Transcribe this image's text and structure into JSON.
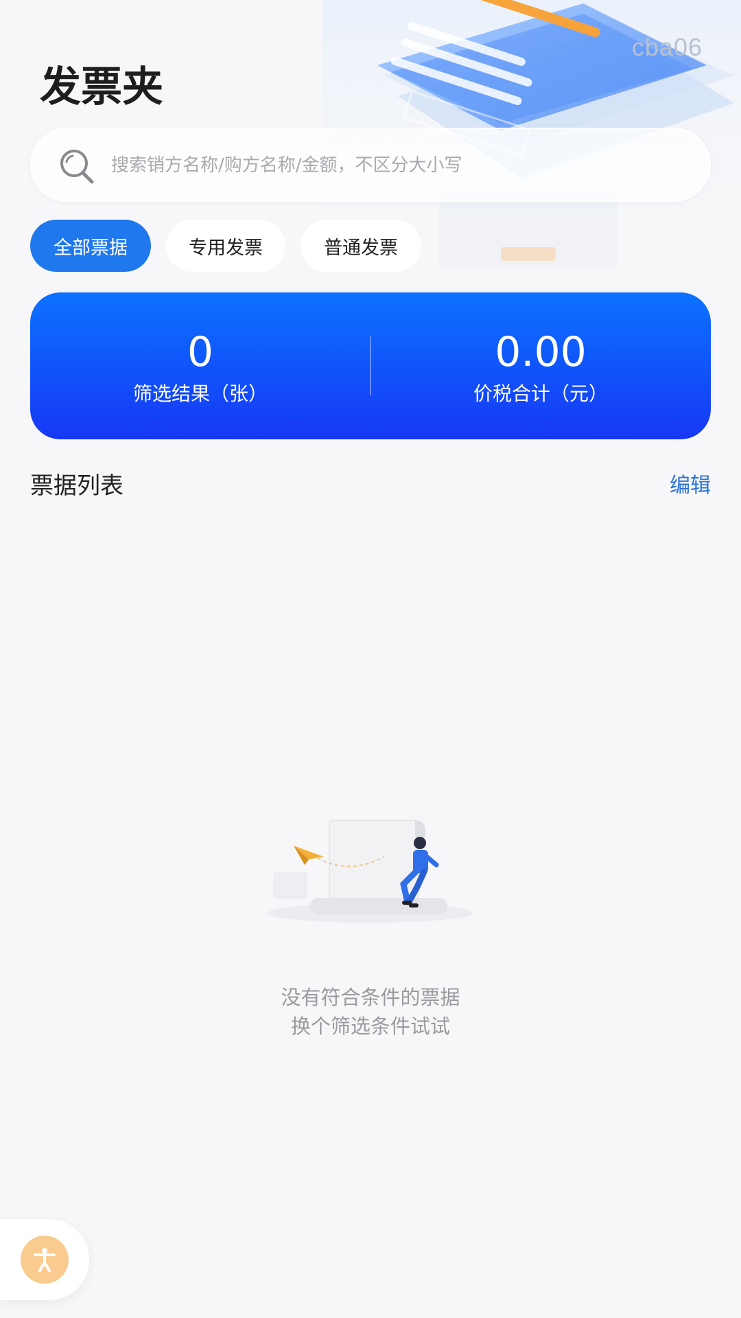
{
  "header": {
    "title": "发票夹",
    "user_tag": "cba06"
  },
  "search": {
    "placeholder": "搜索销方名称/购方名称/金额，不区分大小写",
    "value": ""
  },
  "filter_tabs": [
    {
      "label": "全部票据",
      "active": true
    },
    {
      "label": "专用发票",
      "active": false
    },
    {
      "label": "普通发票",
      "active": false
    }
  ],
  "summary": {
    "count_value": "0",
    "count_label": "筛选结果（张）",
    "total_value": "0.00",
    "total_label": "价税合计（元）"
  },
  "list": {
    "title": "票据列表",
    "edit_label": "编辑"
  },
  "empty_state": {
    "line1": "没有符合条件的票据",
    "line2": "换个筛选条件试试"
  },
  "icons": {
    "search": "search-icon",
    "accessibility": "accessibility-icon",
    "empty": "empty-state-illustration"
  },
  "colors": {
    "accent": "#1f78ee",
    "card_top": "#0c72ff",
    "card_bottom": "#1638f5",
    "edit_link": "#2a73d8",
    "fab": "#f9cb8e"
  }
}
